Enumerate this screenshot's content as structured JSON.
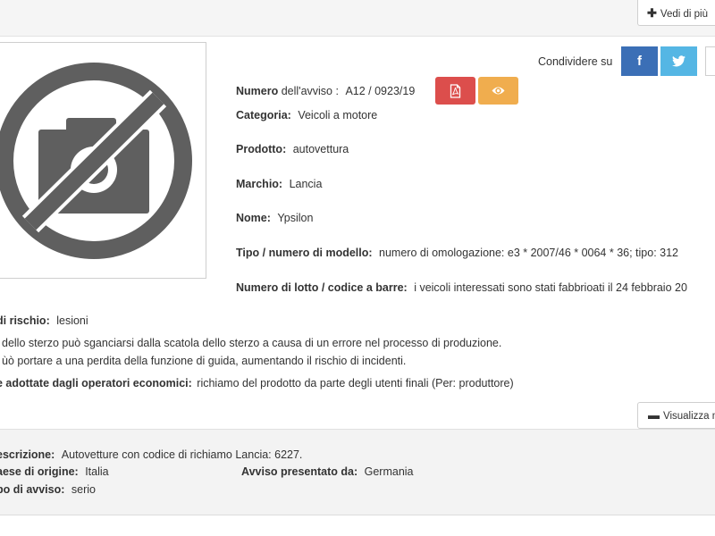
{
  "header": {
    "more_button": "Vedi di più"
  },
  "share": {
    "label": "Condividere su",
    "facebook_icon": "f",
    "twitter_icon": "twitter-bird"
  },
  "notice": {
    "number_label": "Numero",
    "number_suffix": "dell'avviso :",
    "number_value": "A12 / 0923/19",
    "category_label": "Categoria:",
    "category_value": "Veicoli a motore",
    "product_label": "Prodotto:",
    "product_value": "autovettura",
    "brand_label": "Marchio:",
    "brand_value": "Lancia",
    "name_label": "Nome:",
    "name_value": "Ypsilon",
    "model_label": "Tipo / numero di modello:",
    "model_value": "numero di omologazione: e3 * 2007/46 * 0064 * 36; tipo: 312",
    "batch_label": "Numero di lotto / codice a barre:",
    "batch_value": "i veicoli interessati sono stati fabbrioati il 24 febbraio 20"
  },
  "risk": {
    "type_label": "di rischio:",
    "type_value": "lesioni",
    "line1": "dello sterzo può sganciarsi dalla scatola dello sterzo a causa di un errore nel processo di produzione.",
    "line2": "ùò portare a una perdita della funzione di guida, aumentando il rischio di incidenti.",
    "measures_label": "e adottate dagli operatori economici:",
    "measures_value": "richiamo del prodotto da parte degli utenti finali (Per: produttore)"
  },
  "toggle": {
    "less_button": "Visualizza m"
  },
  "details": {
    "description_label": "escrizione:",
    "description_value": "Autovetture con codice di richiamo Lancia: 6227.",
    "origin_label": "aese di origine:",
    "origin_value": "Italia",
    "submitted_label": "Avviso presentato da:",
    "submitted_value": "Germania",
    "notice_type_label": "po di avviso:",
    "notice_type_value": "serio"
  },
  "colors": {
    "pdf_button": "#dc4e4c",
    "view_button": "#f0ad4e",
    "facebook": "#3b6fb6",
    "twitter": "#55b6e4",
    "no_photo_icon": "#5f5f5f"
  },
  "icons": {
    "photo": "no-photo-icon",
    "pdf": "pdf-icon",
    "view": "eye-icon",
    "plus": "plus-icon",
    "minus": "minus-icon"
  }
}
